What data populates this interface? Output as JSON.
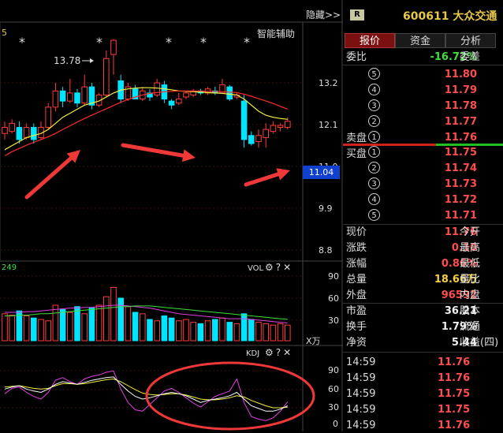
{
  "toolbar": {
    "hide_label": "隐藏>>"
  },
  "main_chart": {
    "top_left_tag": "5",
    "assist_label": "智能辅助",
    "high_annotation": "13.78",
    "current_price_tag": "11.04",
    "y_ticks": [
      "13.2",
      "12.1",
      "11.0",
      "9.9",
      "8.8"
    ],
    "star_glyph": "*"
  },
  "volume": {
    "title": "VOL",
    "top_left_value": "249",
    "y_ticks": [
      "90",
      "60",
      "30"
    ],
    "unit": "X万"
  },
  "kdj": {
    "title": "KDJ",
    "y_ticks": [
      "90",
      "60",
      "30",
      "0"
    ]
  },
  "panel": {
    "badge": "R",
    "stock_code": "600611",
    "stock_name": "大众交通",
    "tabs": [
      "报价",
      "资金",
      "分析"
    ],
    "weibi_label": "委比",
    "weibi_value": "-16.72%",
    "weicha_label": "委差",
    "sell_label": "卖盘",
    "buy_label": "买盘",
    "sell_levels": [
      {
        "n": "5",
        "price": "11.80"
      },
      {
        "n": "4",
        "price": "11.79"
      },
      {
        "n": "3",
        "price": "11.78"
      },
      {
        "n": "2",
        "price": "11.77"
      },
      {
        "n": "1",
        "price": "11.76"
      }
    ],
    "buy_levels": [
      {
        "n": "1",
        "price": "11.75"
      },
      {
        "n": "2",
        "price": "11.74"
      },
      {
        "n": "3",
        "price": "11.73"
      },
      {
        "n": "4",
        "price": "11.72"
      },
      {
        "n": "5",
        "price": "11.71"
      }
    ],
    "stats": [
      {
        "l": "现价",
        "v": "11.76",
        "r": "今开",
        "c": "red"
      },
      {
        "l": "涨跌",
        "v": "0.10",
        "r": "最高",
        "c": "red"
      },
      {
        "l": "涨幅",
        "v": "0.86%",
        "r": "最低",
        "c": "red"
      },
      {
        "l": "总量",
        "v": "18.66万",
        "r": "量比",
        "c": "yel"
      },
      {
        "l": "外盘",
        "v": "96592",
        "r": "内盘",
        "c": "red"
      }
    ],
    "stats2": [
      {
        "l": "市盈",
        "v": "36.21",
        "r": "股本",
        "c": "wht"
      },
      {
        "l": "换手",
        "v": "1.79%",
        "r": "流通",
        "c": "wht"
      },
      {
        "l": "净资",
        "v": "5.44",
        "r": "收益(四)",
        "c": "wht"
      }
    ],
    "ticks": [
      {
        "t": "14:59",
        "p": "11.76"
      },
      {
        "t": "14:59",
        "p": "11.76"
      },
      {
        "t": "14:59",
        "p": "11.75"
      },
      {
        "t": "14:59",
        "p": "11.75"
      },
      {
        "t": "14:59",
        "p": "11.76"
      }
    ]
  },
  "colors": {
    "up": "#ff3c3c",
    "down": "#00e5ff",
    "ma5": "#f4f040",
    "ma10": "#ff2a2a",
    "k": "#ffffff",
    "d": "#f4f040",
    "j": "#e040e0"
  },
  "chart_data": {
    "type": "candlestick",
    "price_range": [
      8.3,
      14.2
    ],
    "candles": [
      {
        "o": 11.45,
        "c": 11.6,
        "h": 11.75,
        "l": 11.3
      },
      {
        "o": 11.5,
        "c": 11.7,
        "h": 11.8,
        "l": 11.45
      },
      {
        "o": 11.6,
        "c": 11.3,
        "h": 11.75,
        "l": 11.2
      },
      {
        "o": 11.35,
        "c": 11.6,
        "h": 11.7,
        "l": 11.3
      },
      {
        "o": 11.6,
        "c": 11.3,
        "h": 11.7,
        "l": 11.2
      },
      {
        "o": 11.35,
        "c": 11.6,
        "h": 11.75,
        "l": 11.3
      },
      {
        "o": 11.6,
        "c": 12.1,
        "h": 12.2,
        "l": 11.55
      },
      {
        "o": 12.1,
        "c": 12.5,
        "h": 12.7,
        "l": 12.0
      },
      {
        "o": 12.5,
        "c": 12.25,
        "h": 12.6,
        "l": 12.1
      },
      {
        "o": 12.25,
        "c": 12.45,
        "h": 12.8,
        "l": 12.2
      },
      {
        "o": 12.45,
        "c": 12.2,
        "h": 12.55,
        "l": 12.1
      },
      {
        "o": 12.2,
        "c": 12.6,
        "h": 12.9,
        "l": 12.15
      },
      {
        "o": 12.6,
        "c": 12.15,
        "h": 12.7,
        "l": 12.05
      },
      {
        "o": 12.15,
        "c": 12.4,
        "h": 12.45,
        "l": 12.1
      },
      {
        "o": 12.4,
        "c": 13.3,
        "h": 13.5,
        "l": 12.35
      },
      {
        "o": 13.4,
        "c": 13.75,
        "h": 13.78,
        "l": 12.9
      },
      {
        "o": 12.75,
        "c": 12.3,
        "h": 12.9,
        "l": 12.2
      },
      {
        "o": 12.3,
        "c": 12.6,
        "h": 12.7,
        "l": 12.25
      },
      {
        "o": 12.55,
        "c": 12.3,
        "h": 12.65,
        "l": 12.3
      },
      {
        "o": 12.3,
        "c": 12.5,
        "h": 12.6,
        "l": 12.25
      },
      {
        "o": 12.45,
        "c": 12.35,
        "h": 12.55,
        "l": 12.25
      },
      {
        "o": 12.4,
        "c": 12.7,
        "h": 12.8,
        "l": 12.35
      },
      {
        "o": 12.65,
        "c": 12.3,
        "h": 12.75,
        "l": 12.2
      },
      {
        "o": 12.25,
        "c": 12.15,
        "h": 12.3,
        "l": 12.05
      },
      {
        "o": 12.2,
        "c": 12.3,
        "h": 12.45,
        "l": 12.15
      },
      {
        "o": 12.35,
        "c": 12.45,
        "h": 12.5,
        "l": 12.3
      },
      {
        "o": 12.4,
        "c": 12.5,
        "h": 12.55,
        "l": 12.35
      },
      {
        "o": 12.5,
        "c": 12.45,
        "h": 12.55,
        "l": 12.4
      },
      {
        "o": 12.45,
        "c": 12.55,
        "h": 12.6,
        "l": 12.4
      },
      {
        "o": 12.5,
        "c": 12.45,
        "h": 12.6,
        "l": 12.4
      },
      {
        "o": 12.45,
        "c": 12.65,
        "h": 12.8,
        "l": 12.45
      },
      {
        "o": 12.6,
        "c": 12.3,
        "h": 12.65,
        "l": 12.25
      },
      {
        "o": 12.35,
        "c": 12.4,
        "h": 12.45,
        "l": 12.3
      },
      {
        "o": 12.25,
        "c": 11.3,
        "h": 12.4,
        "l": 11.1
      },
      {
        "o": 11.4,
        "c": 11.2,
        "h": 11.5,
        "l": 11.15
      },
      {
        "o": 11.25,
        "c": 11.4,
        "h": 11.55,
        "l": 11.1
      },
      {
        "o": 11.35,
        "c": 11.55,
        "h": 11.7,
        "l": 11.1
      },
      {
        "o": 11.5,
        "c": 11.65,
        "h": 11.75,
        "l": 11.45
      },
      {
        "o": 11.6,
        "c": 11.65,
        "h": 11.7,
        "l": 11.5
      },
      {
        "o": 11.6,
        "c": 11.75,
        "h": 11.85,
        "l": 11.55
      }
    ],
    "ma_a": [
      11.05,
      11.15,
      11.25,
      11.35,
      11.4,
      11.45,
      11.55,
      11.7,
      11.85,
      11.95,
      12.05,
      12.15,
      12.2,
      12.25,
      12.35,
      12.45,
      12.52,
      12.55,
      12.57,
      12.58,
      12.58,
      12.57,
      12.55,
      12.53,
      12.5,
      12.49,
      12.48,
      12.47,
      12.46,
      12.45,
      12.44,
      12.42,
      12.4,
      12.3,
      12.15,
      12.0,
      11.9,
      11.85,
      11.82,
      11.8
    ],
    "ma_b": [
      10.9,
      11.0,
      11.08,
      11.16,
      11.23,
      11.3,
      11.37,
      11.45,
      11.55,
      11.64,
      11.73,
      11.82,
      11.9,
      11.98,
      12.06,
      12.14,
      12.22,
      12.29,
      12.35,
      12.4,
      12.44,
      12.46,
      12.48,
      12.49,
      12.5,
      12.5,
      12.5,
      12.5,
      12.49,
      12.49,
      12.48,
      12.47,
      12.46,
      12.42,
      12.37,
      12.31,
      12.25,
      12.19,
      12.12,
      12.05
    ],
    "volumes": [
      38,
      36,
      42,
      35,
      32,
      30,
      28,
      50,
      44,
      40,
      48,
      38,
      46,
      50,
      62,
      75,
      60,
      48,
      40,
      38,
      30,
      28,
      35,
      32,
      28,
      30,
      26,
      24,
      28,
      30,
      32,
      26,
      24,
      38,
      30,
      26,
      24,
      22,
      24,
      22
    ],
    "vol_ma_a": [
      40,
      40,
      40,
      41,
      41,
      42,
      43,
      44,
      45,
      46,
      46,
      47,
      47,
      48,
      49,
      50,
      50,
      49,
      48,
      47,
      46,
      44,
      42,
      40,
      38,
      37,
      36,
      35,
      34,
      33,
      32,
      31,
      31,
      31,
      30,
      29,
      28,
      27,
      26,
      25
    ],
    "vol_ma_b": [
      35,
      35,
      36,
      36,
      37,
      38,
      38,
      39,
      40,
      41,
      42,
      43,
      44,
      45,
      46,
      47,
      48,
      48,
      49,
      49,
      49,
      48,
      47,
      46,
      45,
      44,
      43,
      42,
      41,
      40,
      39,
      38,
      37,
      36,
      35,
      34,
      33,
      32,
      31,
      30
    ],
    "kdj_k": [
      55,
      58,
      60,
      55,
      52,
      50,
      55,
      62,
      66,
      64,
      62,
      65,
      68,
      70,
      72,
      73,
      62,
      52,
      44,
      40,
      42,
      45,
      48,
      50,
      48,
      45,
      40,
      35,
      38,
      40,
      42,
      45,
      50,
      40,
      30,
      26,
      22,
      22,
      25,
      30
    ],
    "kdj_d": [
      58,
      59,
      60,
      58,
      56,
      55,
      56,
      60,
      63,
      63,
      62,
      63,
      65,
      67,
      69,
      70,
      66,
      60,
      54,
      49,
      47,
      46,
      47,
      48,
      48,
      46,
      43,
      40,
      39,
      39,
      40,
      42,
      45,
      43,
      38,
      34,
      30,
      27,
      27,
      28
    ],
    "kdj_j": [
      48,
      56,
      58,
      50,
      44,
      40,
      50,
      68,
      72,
      66,
      62,
      70,
      74,
      76,
      80,
      82,
      55,
      35,
      24,
      22,
      32,
      42,
      52,
      56,
      50,
      42,
      34,
      28,
      36,
      44,
      48,
      52,
      70,
      35,
      14,
      10,
      8,
      12,
      22,
      36
    ],
    "kdj_range": [
      0,
      100
    ],
    "vol_range": [
      0,
      100
    ]
  }
}
